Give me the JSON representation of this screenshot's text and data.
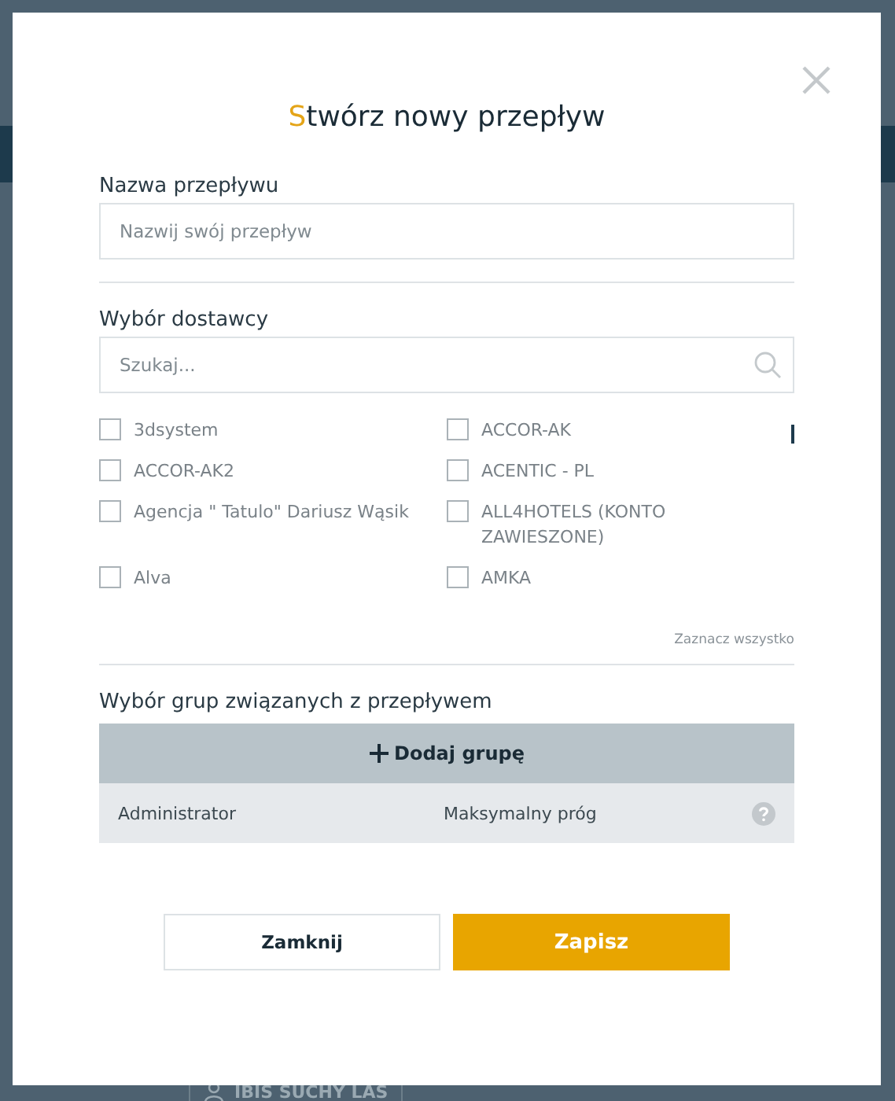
{
  "background": {
    "label": "IBIS SUCHY LAS"
  },
  "dialog": {
    "title": "Stwórz nowy przepływ",
    "name_field": {
      "label": "Nazwa przepływu",
      "placeholder": "Nazwij swój przepływ"
    },
    "supplier_section": {
      "label": "Wybór dostawcy",
      "search": {
        "placeholder": "Szukaj..."
      },
      "suppliers": [
        {
          "label": "3dsystem",
          "checked": false
        },
        {
          "label": "ACCOR-AK",
          "checked": false
        },
        {
          "label": "ACCOR-AK2",
          "checked": false
        },
        {
          "label": "ACENTIC - PL",
          "checked": false
        },
        {
          "label": "Agencja \" Tatulo\" Dariusz Wąsik",
          "checked": false
        },
        {
          "label": "ALL4HOTELS (KONTO ZAWIESZONE)",
          "checked": false
        },
        {
          "label": "Alva",
          "checked": false
        },
        {
          "label": "AMKA",
          "checked": false
        }
      ],
      "select_all": "Zaznacz wszystko"
    },
    "groups_section": {
      "label": "Wybór grup związanych z przepływem",
      "add_button": "Dodaj grupę",
      "rows": [
        {
          "group": "Administrator",
          "threshold": "Maksymalny próg"
        }
      ]
    },
    "buttons": [
      {
        "label": "Zamknij",
        "kind": "secondary"
      },
      {
        "label": "Zapisz",
        "kind": "primary"
      }
    ]
  }
}
